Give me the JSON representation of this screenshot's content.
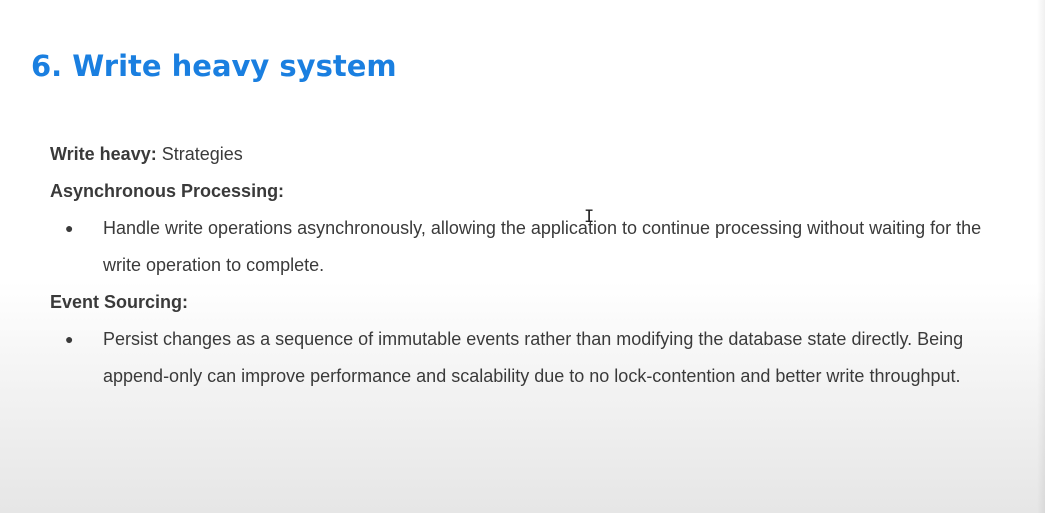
{
  "slide": {
    "title": "6. Write heavy system",
    "intro": {
      "label": "Write heavy:",
      "value": " Strategies"
    },
    "sections": [
      {
        "heading": "Asynchronous Processing:",
        "bullets": [
          "Handle write operations asynchronously, allowing the application to continue processing without waiting for the write operation to complete."
        ]
      },
      {
        "heading": "Event Sourcing:",
        "bullets": [
          "Persist changes as a sequence of immutable events rather than modifying the database state directly. Being append-only can improve performance and scalability due to no lock-contention and better write throughput."
        ]
      }
    ],
    "bullet_glyph": "●",
    "cursor_icon": "text-cursor-icon",
    "cursor_glyph": "I",
    "colors": {
      "title": "#1a7fe0",
      "body_text": "#3a3a3a"
    }
  }
}
